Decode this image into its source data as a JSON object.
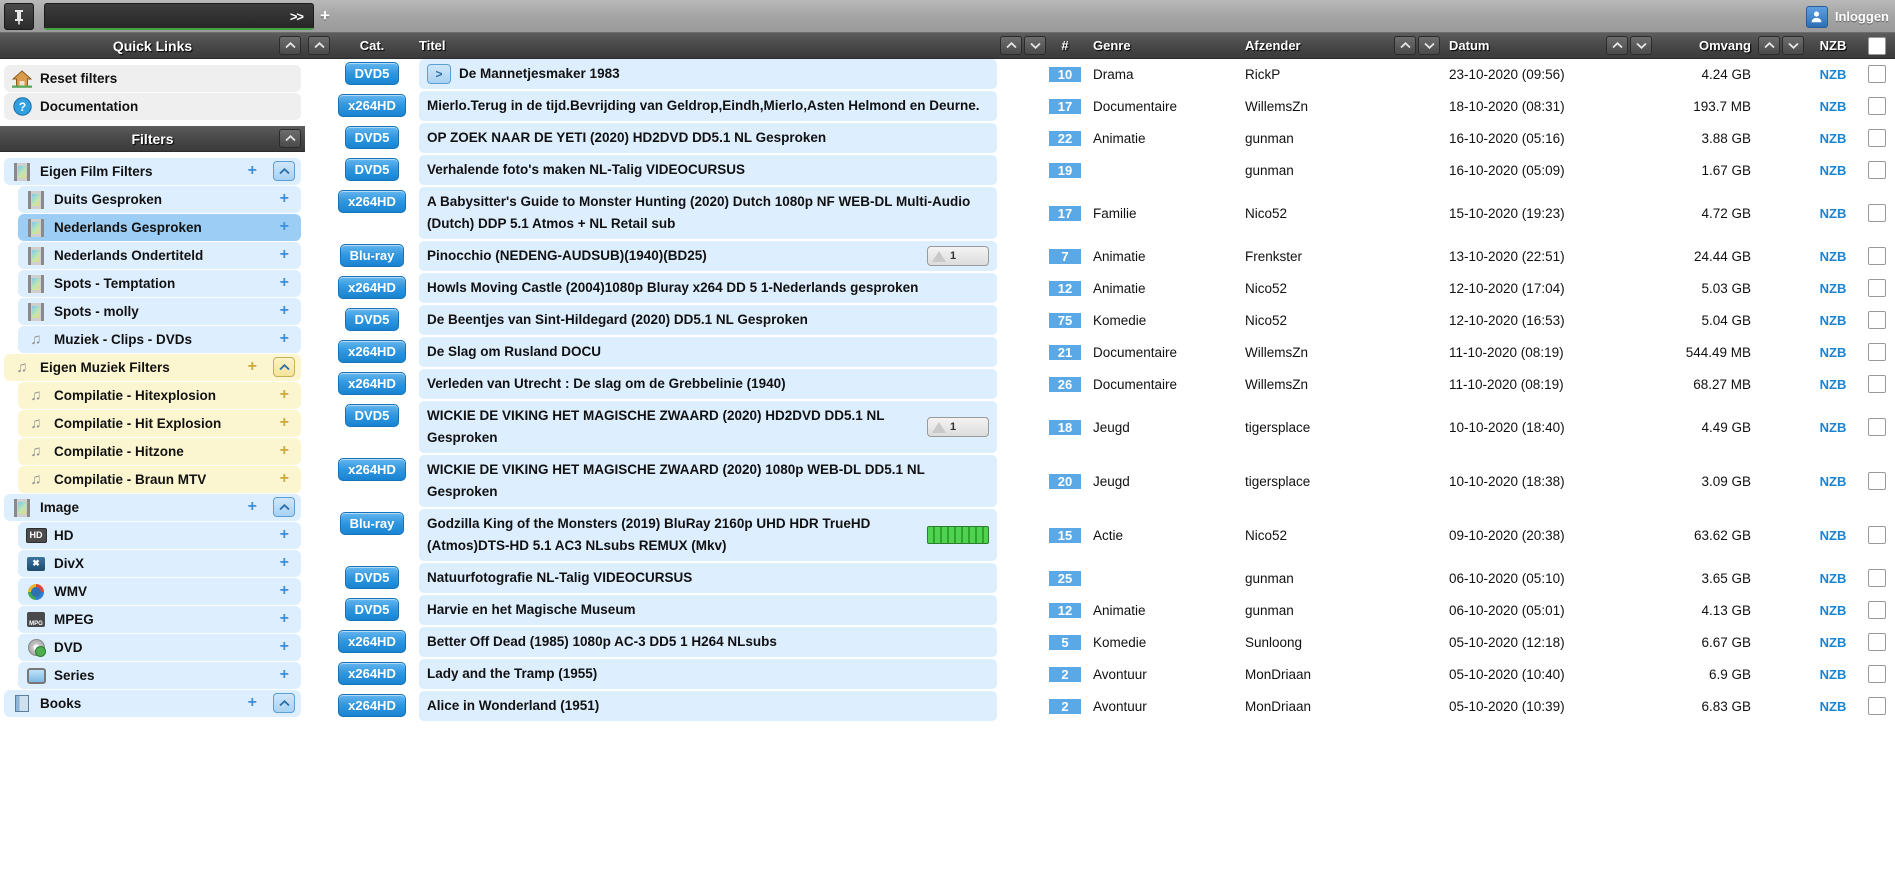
{
  "topbar": {
    "pin_title": "pin",
    "search_value": "",
    "search_placeholder": "",
    "expand_label": ">>",
    "add_label": "+",
    "login_label": "Inloggen"
  },
  "sidebar": {
    "quick_links_title": "Quick Links",
    "filters_title": "Filters",
    "quick_links": [
      {
        "label": "Reset filters",
        "icon": "home-icon",
        "style": "plain"
      },
      {
        "label": "Documentation",
        "icon": "help-icon",
        "style": "plain"
      }
    ],
    "groups": [
      {
        "label": "Eigen Film Filters",
        "icon": "film-icon",
        "style": "blue",
        "plus": "+",
        "caret": "∧",
        "children": [
          {
            "label": "Duits Gesproken",
            "icon": "film-icon",
            "style": "blue",
            "plus": "+"
          },
          {
            "label": "Nederlands Gesproken",
            "icon": "film-icon",
            "style": "blue-sel",
            "plus": "+"
          },
          {
            "label": "Nederlands Ondertiteld",
            "icon": "film-icon",
            "style": "blue",
            "plus": "+"
          },
          {
            "label": "Spots - Temptation",
            "icon": "film-icon",
            "style": "blue",
            "plus": "+"
          },
          {
            "label": "Spots - molly",
            "icon": "film-icon",
            "style": "blue",
            "plus": "+"
          },
          {
            "label": "Muziek - Clips - DVDs",
            "icon": "note-icon",
            "style": "blue",
            "plus": "+"
          }
        ]
      },
      {
        "label": "Eigen Muziek Filters",
        "icon": "note-icon",
        "style": "yellow",
        "plus": "+",
        "caret": "∧",
        "children": [
          {
            "label": "Compilatie - Hitexplosion",
            "icon": "note-icon",
            "style": "yellow",
            "plus": "+"
          },
          {
            "label": "Compilatie - Hit Explosion",
            "icon": "note-icon",
            "style": "yellow",
            "plus": "+"
          },
          {
            "label": "Compilatie - Hitzone",
            "icon": "note-icon",
            "style": "yellow",
            "plus": "+"
          },
          {
            "label": "Compilatie - Braun MTV",
            "icon": "note-icon",
            "style": "yellow",
            "plus": "+"
          }
        ]
      },
      {
        "label": "Image",
        "icon": "film-icon",
        "style": "blue",
        "plus": "+",
        "caret": "∧",
        "children": [
          {
            "label": "HD",
            "icon": "hd-icon",
            "style": "blue",
            "plus": "+"
          },
          {
            "label": "DivX",
            "icon": "divx-icon",
            "style": "blue",
            "plus": "+"
          },
          {
            "label": "WMV",
            "icon": "wmv-icon",
            "style": "blue",
            "plus": "+"
          },
          {
            "label": "MPEG",
            "icon": "mpeg-icon",
            "style": "blue",
            "plus": "+"
          },
          {
            "label": "DVD",
            "icon": "dvd-icon",
            "style": "blue",
            "plus": "+"
          },
          {
            "label": "Series",
            "icon": "tv-icon",
            "style": "blue",
            "plus": "+"
          }
        ]
      },
      {
        "label": "Books",
        "icon": "book-icon",
        "style": "blue",
        "plus": "+",
        "caret": "∧",
        "children": []
      }
    ]
  },
  "table": {
    "headers": {
      "cat": "Cat.",
      "titel": "Titel",
      "num": "#",
      "genre": "Genre",
      "afzender": "Afzender",
      "datum": "Datum",
      "omvang": "Omvang",
      "nzb": "NZB"
    },
    "sort_up": "∧",
    "sort_down": "∨",
    "nzb_link_label": "NZB",
    "rows": [
      {
        "cat": "DVD5",
        "title": "De Mannetjesmaker 1983",
        "expander": ">",
        "badge": null,
        "num": "10",
        "genre": "Drama",
        "afzender": "RickP",
        "datum": "23-10-2020 (09:56)",
        "omvang": "4.24 GB",
        "nzb": "NZB"
      },
      {
        "cat": "x264HD",
        "title": "Mierlo.Terug in de tijd.Bevrijding van Geldrop,Eindh,Mierlo,Asten Helmond en Deurne.",
        "expander": null,
        "badge": null,
        "num": "17",
        "genre": "Documentaire",
        "afzender": "WillemsZn",
        "datum": "18-10-2020 (08:31)",
        "omvang": "193.7 MB",
        "nzb": "NZB"
      },
      {
        "cat": "DVD5",
        "title": "OP ZOEK NAAR DE YETI (2020) HD2DVD DD5.1 NL Gesproken",
        "expander": null,
        "badge": null,
        "num": "22",
        "genre": "Animatie",
        "afzender": "gunman",
        "datum": "16-10-2020 (05:16)",
        "omvang": "3.88 GB",
        "nzb": "NZB"
      },
      {
        "cat": "DVD5",
        "title": "Verhalende foto's maken NL-Talig VIDEOCURSUS",
        "expander": null,
        "badge": null,
        "num": "19",
        "genre": "",
        "afzender": "gunman",
        "datum": "16-10-2020 (05:09)",
        "omvang": "1.67 GB",
        "nzb": "NZB"
      },
      {
        "cat": "x264HD",
        "title": "A Babysitter's Guide to Monster Hunting (2020) Dutch 1080p NF WEB-DL Multi-Audio (Dutch) DDP 5.1 Atmos + NL Retail sub",
        "expander": null,
        "badge": null,
        "num": "17",
        "genre": "Familie",
        "afzender": "Nico52",
        "datum": "15-10-2020 (19:23)",
        "omvang": "4.72 GB",
        "nzb": "NZB"
      },
      {
        "cat": "Blu-ray",
        "title": "Pinocchio (NEDENG-AUDSUB)(1940)(BD25)",
        "expander": null,
        "badge": {
          "type": "thumb",
          "count": "1"
        },
        "num": "7",
        "genre": "Animatie",
        "afzender": "Frenkster",
        "datum": "13-10-2020 (22:51)",
        "omvang": "24.44 GB",
        "nzb": "NZB"
      },
      {
        "cat": "x264HD",
        "title": "Howls Moving Castle (2004)1080p Bluray x264 DD 5 1-Nederlands gesproken",
        "expander": null,
        "badge": null,
        "num": "12",
        "genre": "Animatie",
        "afzender": "Nico52",
        "datum": "12-10-2020 (17:04)",
        "omvang": "5.03 GB",
        "nzb": "NZB"
      },
      {
        "cat": "DVD5",
        "title": "De Beentjes van Sint-Hildegard (2020) DD5.1 NL Gesproken",
        "expander": null,
        "badge": null,
        "num": "75",
        "genre": "Komedie",
        "afzender": "Nico52",
        "datum": "12-10-2020 (16:53)",
        "omvang": "5.04 GB",
        "nzb": "NZB"
      },
      {
        "cat": "x264HD",
        "title": "De Slag om Rusland DOCU",
        "expander": null,
        "badge": null,
        "num": "21",
        "genre": "Documentaire",
        "afzender": "WillemsZn",
        "datum": "11-10-2020 (08:19)",
        "omvang": "544.49 MB",
        "nzb": "NZB"
      },
      {
        "cat": "x264HD",
        "title": "Verleden van Utrecht : De slag om de Grebbelinie (1940)",
        "expander": null,
        "badge": null,
        "num": "26",
        "genre": "Documentaire",
        "afzender": "WillemsZn",
        "datum": "11-10-2020 (08:19)",
        "omvang": "68.27 MB",
        "nzb": "NZB"
      },
      {
        "cat": "DVD5",
        "title": "WICKIE DE VIKING HET MAGISCHE ZWAARD (2020) HD2DVD DD5.1 NL Gesproken",
        "expander": null,
        "badge": {
          "type": "thumb",
          "count": "1"
        },
        "num": "18",
        "genre": "Jeugd",
        "afzender": "tigersplace",
        "datum": "10-10-2020 (18:40)",
        "omvang": "4.49 GB",
        "nzb": "NZB"
      },
      {
        "cat": "x264HD",
        "title": "WICKIE DE VIKING HET MAGISCHE ZWAARD (2020) 1080p WEB-DL DD5.1 NL Gesproken",
        "expander": null,
        "badge": null,
        "num": "20",
        "genre": "Jeugd",
        "afzender": "tigersplace",
        "datum": "10-10-2020 (18:38)",
        "omvang": "3.09 GB",
        "nzb": "NZB"
      },
      {
        "cat": "Blu-ray",
        "title": "Godzilla King of the Monsters (2019) BluRay 2160p UHD HDR TrueHD (Atmos)DTS-HD 5.1 AC3 NLsubs REMUX (Mkv)",
        "expander": null,
        "badge": {
          "type": "progress",
          "count": ""
        },
        "num": "15",
        "genre": "Actie",
        "afzender": "Nico52",
        "datum": "09-10-2020 (20:38)",
        "omvang": "63.62 GB",
        "nzb": "NZB"
      },
      {
        "cat": "DVD5",
        "title": "Natuurfotografie NL-Talig VIDEOCURSUS",
        "expander": null,
        "badge": null,
        "num": "25",
        "genre": "",
        "afzender": "gunman",
        "datum": "06-10-2020 (05:10)",
        "omvang": "3.65 GB",
        "nzb": "NZB"
      },
      {
        "cat": "DVD5",
        "title": "Harvie en het Magische Museum",
        "expander": null,
        "badge": null,
        "num": "12",
        "genre": "Animatie",
        "afzender": "gunman",
        "datum": "06-10-2020 (05:01)",
        "omvang": "4.13 GB",
        "nzb": "NZB"
      },
      {
        "cat": "x264HD",
        "title": "Better Off Dead (1985) 1080p AC-3 DD5 1 H264 NLsubs",
        "expander": null,
        "badge": null,
        "num": "5",
        "genre": "Komedie",
        "afzender": "Sunloong",
        "datum": "05-10-2020 (12:18)",
        "omvang": "6.67 GB",
        "nzb": "NZB"
      },
      {
        "cat": "x264HD",
        "title": "Lady and the Tramp (1955)",
        "expander": null,
        "badge": null,
        "num": "2",
        "genre": "Avontuur",
        "afzender": "MonDriaan",
        "datum": "05-10-2020 (10:40)",
        "omvang": "6.9 GB",
        "nzb": "NZB"
      },
      {
        "cat": "x264HD",
        "title": "Alice in Wonderland (1951)",
        "expander": null,
        "badge": null,
        "num": "2",
        "genre": "Avontuur",
        "afzender": "MonDriaan",
        "datum": "05-10-2020 (10:39)",
        "omvang": "6.83 GB",
        "nzb": "NZB"
      }
    ]
  },
  "colors": {
    "accent_blue": "#1a84d2",
    "row_blue": "#ddeeff",
    "num_blue": "#5aa9e6",
    "selected_blue": "#9bcdf5",
    "yellow": "#fcf6d0",
    "header_dark": "#4a4a4a"
  }
}
